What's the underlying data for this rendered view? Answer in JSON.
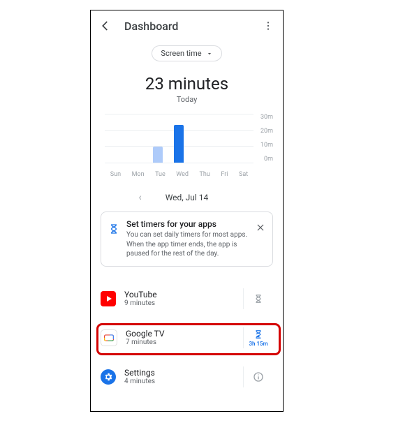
{
  "header": {
    "title": "Dashboard"
  },
  "filter": {
    "label": "Screen time"
  },
  "summary": {
    "value": "23 minutes",
    "period": "Today"
  },
  "chart_data": {
    "type": "bar",
    "categories": [
      "Sun",
      "Mon",
      "Tue",
      "Wed",
      "Thu",
      "Fri",
      "Sat"
    ],
    "values": [
      0,
      0,
      10,
      23,
      0,
      0,
      0
    ],
    "colors": [
      "#e8f0fe",
      "#e8f0fe",
      "#aecbfa",
      "#1a73e8",
      "#e8f0fe",
      "#e8f0fe",
      "#e8f0fe"
    ],
    "ylabel": "minutes",
    "y_ticks": [
      "30m",
      "20m",
      "10m",
      "0m"
    ],
    "ylim": [
      0,
      30
    ]
  },
  "dateNav": {
    "label": "Wed, Jul 14"
  },
  "tip": {
    "title": "Set timers for your apps",
    "body": "You can set daily timers for most apps. When the app timer ends, the app is paused for the rest of the day."
  },
  "apps": {
    "youtube": {
      "name": "YouTube",
      "sub": "9 minutes",
      "timer": null
    },
    "googletv": {
      "name": "Google TV",
      "sub": "7 minutes",
      "timer": "3h 15m"
    },
    "settings": {
      "name": "Settings",
      "sub": "4 minutes",
      "timer": null
    }
  }
}
